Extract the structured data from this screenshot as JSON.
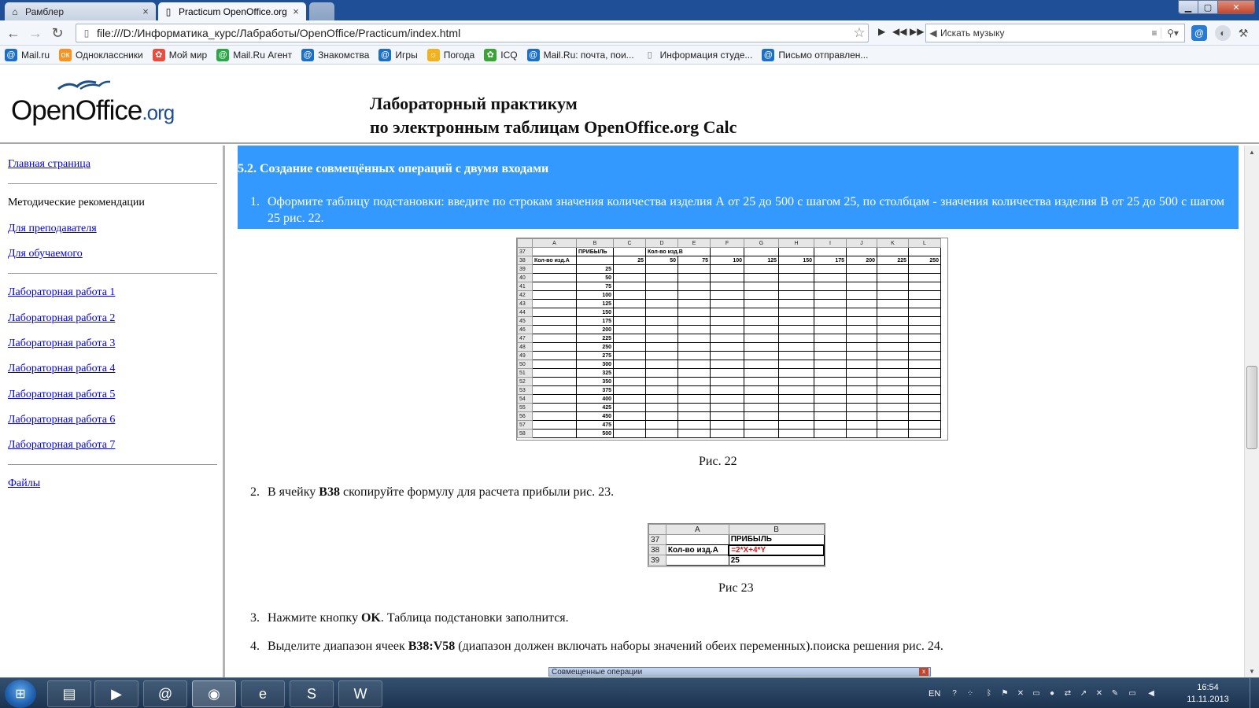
{
  "browser": {
    "tabs": [
      {
        "title": "Рамблер",
        "icon": "home-icon",
        "active": false
      },
      {
        "title": "Practicum OpenOffice.org",
        "icon": "page-icon",
        "active": true
      }
    ],
    "address": "file:///D:/Информатика_курс/Лабработы/OpenOffice/Practicum/index.html",
    "music_search_placeholder": "Искать музыку",
    "bookmarks": [
      {
        "label": "Mail.ru",
        "icon": "mailru-icon",
        "color": "#1b6fc4"
      },
      {
        "label": "Одноклассники",
        "icon": "odnoklassniki-icon",
        "color": "#f7931e"
      },
      {
        "label": "Мой мир",
        "icon": "moimir-icon",
        "color": "#e84c3d"
      },
      {
        "label": "Mail.Ru Агент",
        "icon": "agent-icon",
        "color": "#2aa845"
      },
      {
        "label": "Знакомства",
        "icon": "znakomstva-icon",
        "color": "#1b6fc4"
      },
      {
        "label": "Игры",
        "icon": "games-icon",
        "color": "#1b6fc4"
      },
      {
        "label": "Погода",
        "icon": "weather-icon",
        "color": "#f3b21b"
      },
      {
        "label": "ICQ",
        "icon": "icq-icon",
        "color": "#3aa534"
      },
      {
        "label": "Mail.Ru: почта, пои...",
        "icon": "mailru-icon",
        "color": "#1b6fc4"
      },
      {
        "label": "Информация студе...",
        "icon": "page-icon",
        "color": "#888888"
      },
      {
        "label": "Письмо отправлен...",
        "icon": "mailru-icon",
        "color": "#1b6fc4"
      }
    ]
  },
  "header": {
    "logo_main": "OpenOffice",
    "logo_org": ".org",
    "title_line1": "Лабораторный практикум",
    "title_line2": "по электронным таблицам OpenOffice.org Calc"
  },
  "sidebar": {
    "home": "Главная страница",
    "methodics": "Методические рекомендации",
    "for_teacher": "Для преподавателя",
    "for_student": "Для обучаемого",
    "labs": [
      "Лабораторная работа 1",
      "Лабораторная работа 2",
      "Лабораторная работа 3",
      "Лабораторная работа 4",
      "Лабораторная работа 5",
      "Лабораторная работа 6",
      "Лабораторная работа 7"
    ],
    "files": "Файлы"
  },
  "content": {
    "section_title": "5.2. Создание совмещённых операций с двумя входами",
    "steps": [
      {
        "num": "1.",
        "text": "Оформите таблицу подстановки: введите по строкам значения количества изделия А от 25 до 500 с шагом 25, по столбцам - значения количества изделия В от 25 до 500 с шагом 25 рис. 22."
      },
      {
        "num": "2.",
        "pre": "В ячейку ",
        "bold": "B38",
        "post": " скопируйте формулу для расчета прибыли рис. 23."
      },
      {
        "num": "3.",
        "pre": "Нажмите кнопку ",
        "bold": "OK",
        "post": ". Таблица подстановки заполнится."
      },
      {
        "num": "4.",
        "pre": "Выделите диапазон ячеек ",
        "bold": "B38:V58",
        "post": " (диапазон должен включать наборы значений обеих переменных).поиска решения рис. 24."
      }
    ],
    "fig22_caption": "Рис. 22",
    "fig23_caption": "Рис 23",
    "fig22": {
      "columns": [
        "",
        "A",
        "B",
        "C",
        "D",
        "E",
        "F",
        "G",
        "H",
        "I",
        "J",
        "K",
        "L"
      ],
      "row37": {
        "num": "37",
        "b": "ПРИБЫЛЬ",
        "d": "Кол-во изд.В"
      },
      "row38": {
        "num": "38",
        "a": "Кол-во изд.А",
        "values": [
          "25",
          "50",
          "75",
          "100",
          "125",
          "150",
          "175",
          "200",
          "225",
          "250"
        ]
      },
      "rows": [
        {
          "num": "39",
          "b": "25"
        },
        {
          "num": "40",
          "b": "50"
        },
        {
          "num": "41",
          "b": "75"
        },
        {
          "num": "42",
          "b": "100"
        },
        {
          "num": "43",
          "b": "125"
        },
        {
          "num": "44",
          "b": "150"
        },
        {
          "num": "45",
          "b": "175"
        },
        {
          "num": "46",
          "b": "200"
        },
        {
          "num": "47",
          "b": "225"
        },
        {
          "num": "48",
          "b": "250"
        },
        {
          "num": "49",
          "b": "275"
        },
        {
          "num": "50",
          "b": "300"
        },
        {
          "num": "51",
          "b": "325"
        },
        {
          "num": "52",
          "b": "350"
        },
        {
          "num": "53",
          "b": "375"
        },
        {
          "num": "54",
          "b": "400"
        },
        {
          "num": "55",
          "b": "425"
        },
        {
          "num": "56",
          "b": "450"
        },
        {
          "num": "57",
          "b": "475"
        },
        {
          "num": "58",
          "b": "500"
        }
      ]
    },
    "fig23": {
      "columns": [
        "",
        "A",
        "B"
      ],
      "rows": [
        {
          "num": "37",
          "a": "",
          "b": "ПРИБЫЛЬ"
        },
        {
          "num": "38",
          "a": "Кол-во изд.А",
          "b": "=2*X+4*Y"
        },
        {
          "num": "39",
          "a": "",
          "b": "25"
        }
      ]
    },
    "dialog_peek_title": "Совмещенные операции"
  },
  "taskbar": {
    "lang": "EN",
    "time": "16:54",
    "date": "11.11.2013"
  }
}
